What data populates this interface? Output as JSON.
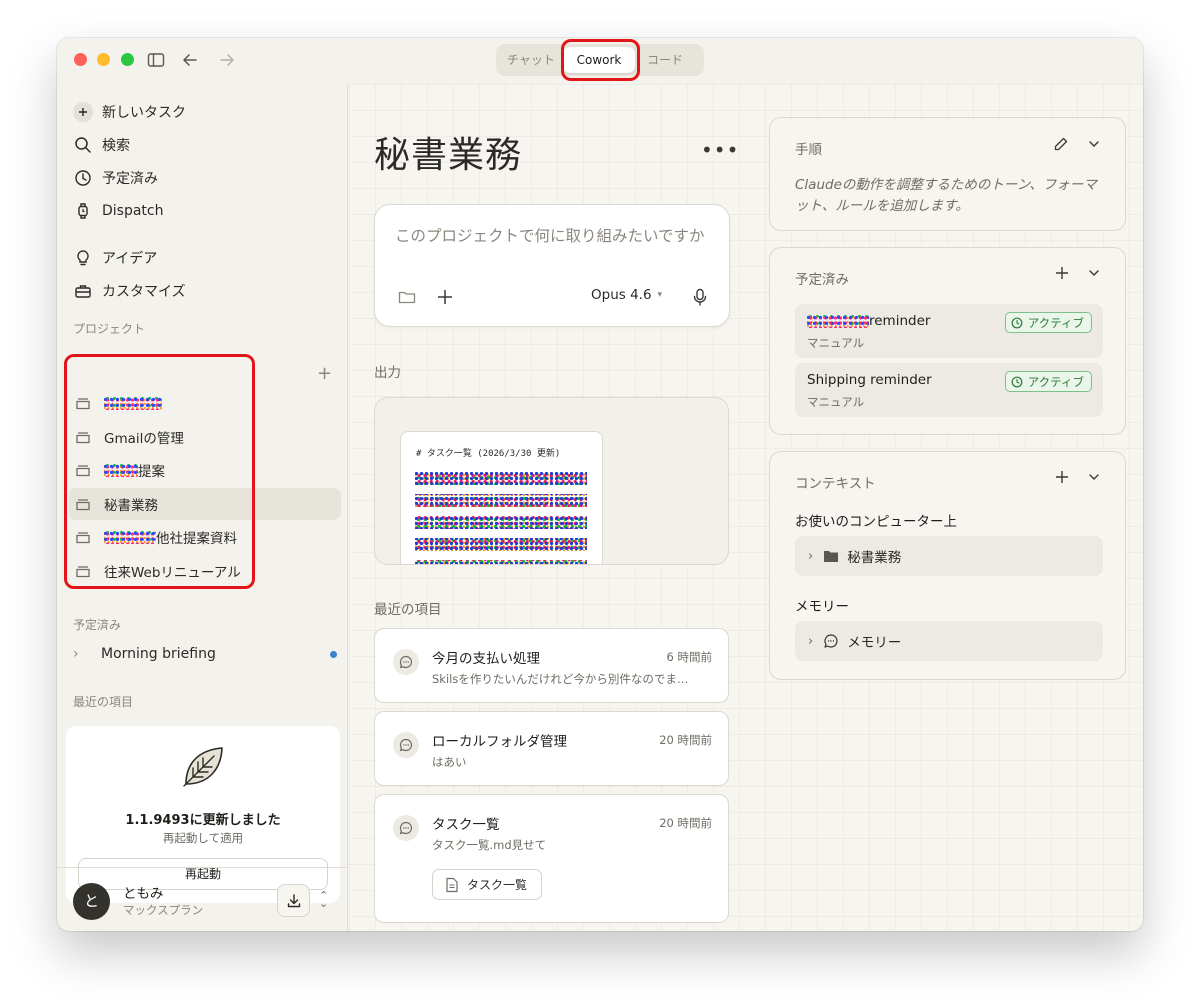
{
  "topbar": {
    "tabs": [
      "チャット",
      "Cowork",
      "コード"
    ],
    "active_tab": "Cowork"
  },
  "sidebar": {
    "nav": [
      {
        "label": "新しいタスク",
        "icon": "plus-icon"
      },
      {
        "label": "検索",
        "icon": "search-icon"
      },
      {
        "label": "予定済み",
        "icon": "clock-icon"
      },
      {
        "label": "Dispatch",
        "icon": "watch-icon"
      },
      {
        "label": "アイデア",
        "icon": "lightbulb-icon"
      },
      {
        "label": "カスタマイズ",
        "icon": "toolbox-icon"
      }
    ],
    "projects_label": "プロジェクト",
    "projects": [
      {
        "label": "",
        "redacted": true
      },
      {
        "label": "Gmailの管理"
      },
      {
        "label": "提案",
        "redacted_prefix": true
      },
      {
        "label": "秘書業務",
        "active": true
      },
      {
        "label": "他社提案資料",
        "redacted_prefix": true
      },
      {
        "label": "往来Webリニューアル"
      }
    ],
    "scheduled_label": "予定済み",
    "scheduled_items": [
      {
        "label": "Morning briefing",
        "unread": true
      }
    ],
    "recent_label": "最近の項目",
    "update": {
      "title": "1.1.9493に更新しました",
      "subtitle": "再起動して適用",
      "button": "再起動"
    },
    "user": {
      "avatar_initial": "と",
      "name": "ともみ",
      "plan": "マックスプラン"
    }
  },
  "main": {
    "title": "秘書業務",
    "composer": {
      "placeholder": "このプロジェクトで何に取り組みたいですか",
      "model": "Opus 4.6"
    },
    "output_label": "出力",
    "output_doc_heading": "# タスク一覧 (2026/3/30 更新)",
    "recent_label": "最近の項目",
    "recent": [
      {
        "title": "今月の支払い処理",
        "time": "6 時間前",
        "preview": "Skilsを作りたいんだけれど今から別件なのでま…"
      },
      {
        "title": "ローカルフォルダ管理",
        "time": "20 時間前",
        "preview": "はあい"
      },
      {
        "title": "タスク一覧",
        "time": "20 時間前",
        "preview": "タスク一覧.md見せて",
        "attachment": "タスク一覧"
      }
    ]
  },
  "right": {
    "instructions": {
      "title": "手順",
      "desc": "Claudeの動作を調整するためのトーン、フォーマット、ルールを追加します。"
    },
    "scheduled": {
      "title": "予定済み",
      "items": [
        {
          "name": "reminder",
          "redacted_prefix": true,
          "mode": "マニュアル",
          "status": "アクティブ"
        },
        {
          "name": "Shipping reminder",
          "mode": "マニュアル",
          "status": "アクティブ"
        }
      ]
    },
    "context": {
      "title": "コンテキスト",
      "computer_label": "お使いのコンピューター上",
      "folder": "秘書業務",
      "memory_label": "メモリー",
      "memory_item": "メモリー"
    }
  },
  "colors": {
    "window_bg": "#f4f2ec",
    "highlight_red": "#e3151b",
    "active_badge": "#2a7a35",
    "unread_dot": "#3b82d6"
  }
}
